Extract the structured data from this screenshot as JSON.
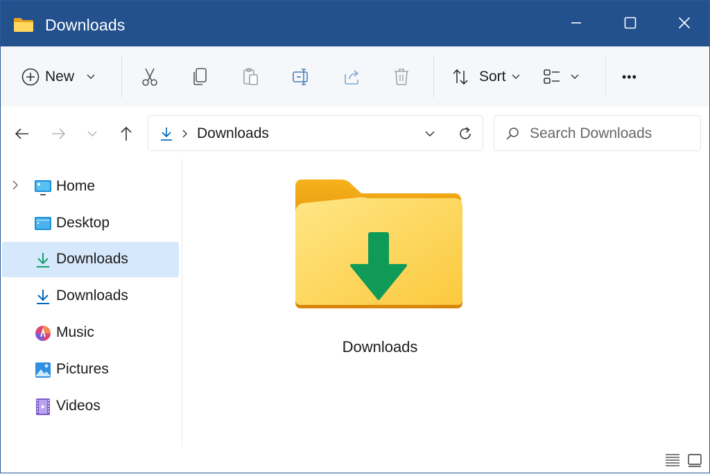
{
  "window": {
    "title": "Downloads"
  },
  "toolbar": {
    "new_label": "New",
    "sort_label": "Sort",
    "more_label": "•••"
  },
  "address": {
    "crumb": "Downloads"
  },
  "search": {
    "placeholder": "Search Downloads"
  },
  "sidebar": {
    "items": [
      {
        "label": "Home",
        "icon": "home-icon"
      },
      {
        "label": "Desktop",
        "icon": "desktop-icon"
      },
      {
        "label": "Downloads",
        "icon": "download-icon",
        "selected": true
      },
      {
        "label": "Downloads",
        "icon": "download-icon"
      },
      {
        "label": "Music",
        "icon": "music-icon"
      },
      {
        "label": "Pictures",
        "icon": "pictures-icon"
      },
      {
        "label": "Videos",
        "icon": "videos-icon"
      }
    ]
  },
  "content": {
    "items": [
      {
        "label": "Downloads",
        "icon": "downloads-folder-icon"
      }
    ]
  },
  "colors": {
    "titlebar": "#23518d",
    "selection": "#d6e8fb",
    "accent": "#0067c0"
  }
}
